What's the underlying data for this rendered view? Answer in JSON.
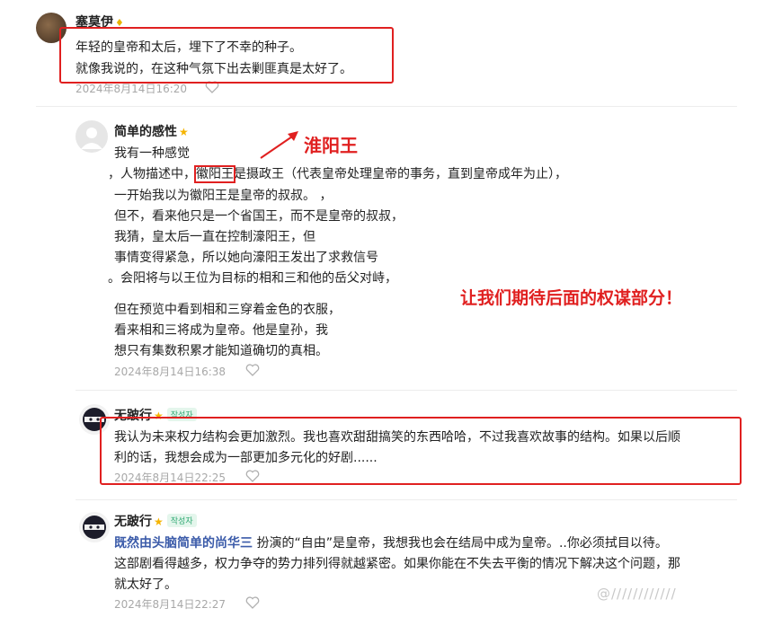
{
  "comments": [
    {
      "author": "塞莫伊",
      "lines": [
        "年轻的皇帝和太后，埋下了不幸的种子。",
        "就像我说的，在这种气氛下出去剿匪真是太好了。"
      ],
      "time": "2024年8月14日16:20"
    },
    {
      "author": "简单的感性",
      "star": "★",
      "lines": [
        "我有一种感觉",
        "，人物描述中，",
        "是摄政王（代表皇帝处理皇帝的事务，直到皇帝成年为止），",
        "一开始我以为徽阳王是皇帝的叔叔。  ，",
        "但不，看来他只是一个省国王，而不是皇帝的叔叔，",
        "我猜，皇太后一直在控制濠阳王，但",
        "事情变得紧急，所以她向濠阳王发出了求救信号",
        "。会阳将与以王位为目标的相和三和他的岳父对峙，",
        "但在预览中看到相和三穿着金色的衣服，",
        "看来相和三将成为皇帝。他是皇孙，我",
        "想只有集数积累才能知道确切的真相。"
      ],
      "highlight": "徽阳王",
      "time": "2024年8月14日16:38"
    },
    {
      "author": "无跛行",
      "star": "★",
      "badge": "작성자",
      "lines": [
        "我认为未来权力结构会更加激烈。我也喜欢甜甜搞笑的东西哈哈，不过我喜欢故事的结构。如果以后顺",
        "利的话，我想会成为一部更加多元化的好剧......"
      ],
      "time": "2024年8月14日22:25"
    },
    {
      "author": "无跛行",
      "star": "★",
      "badge": "작성자",
      "mention": "既然由头脑简单的尚华三",
      "lines": [
        " 扮演的“自由”是皇帝，我想我也会在结局中成为皇帝。..你必须拭目以待。",
        "这部剧看得越多，权力争夺的势力排列得就越紧密。如果你能在不失去平衡的情况下解决这个问题，那",
        "就太好了。"
      ],
      "time": "2024年8月14日22:27"
    }
  ],
  "annotations": {
    "label_wang": "淮阳王",
    "label_expect": "让我们期待后面的权谋部分！"
  },
  "watermark": "@////////////",
  "colors": {
    "annotation_red": "#e02020",
    "time_gray": "#a8a8a8",
    "link_blue": "#3b5ba9"
  }
}
